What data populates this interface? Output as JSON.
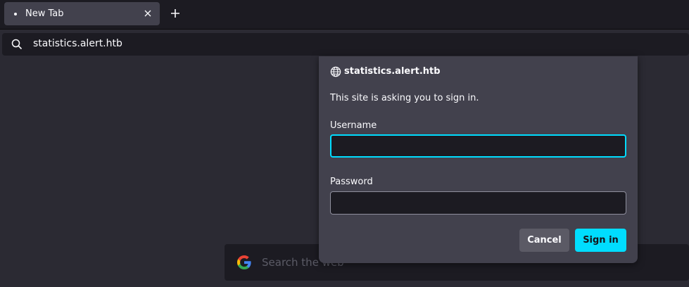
{
  "tabs": [
    {
      "title": "New Tab",
      "active": true
    }
  ],
  "urlbar": {
    "value": "statistics.alert.htb"
  },
  "newtab": {
    "search_placeholder": "Search the web"
  },
  "auth_dialog": {
    "host": "statistics.alert.htb",
    "message": "This site is asking you to sign in.",
    "username_label": "Username",
    "username_value": "",
    "password_label": "Password",
    "password_value": "",
    "cancel_label": "Cancel",
    "signin_label": "Sign in"
  },
  "colors": {
    "accent": "#00ddff",
    "chrome_dark": "#1c1b22",
    "chrome": "#2b2a33",
    "panel": "#42414d"
  }
}
